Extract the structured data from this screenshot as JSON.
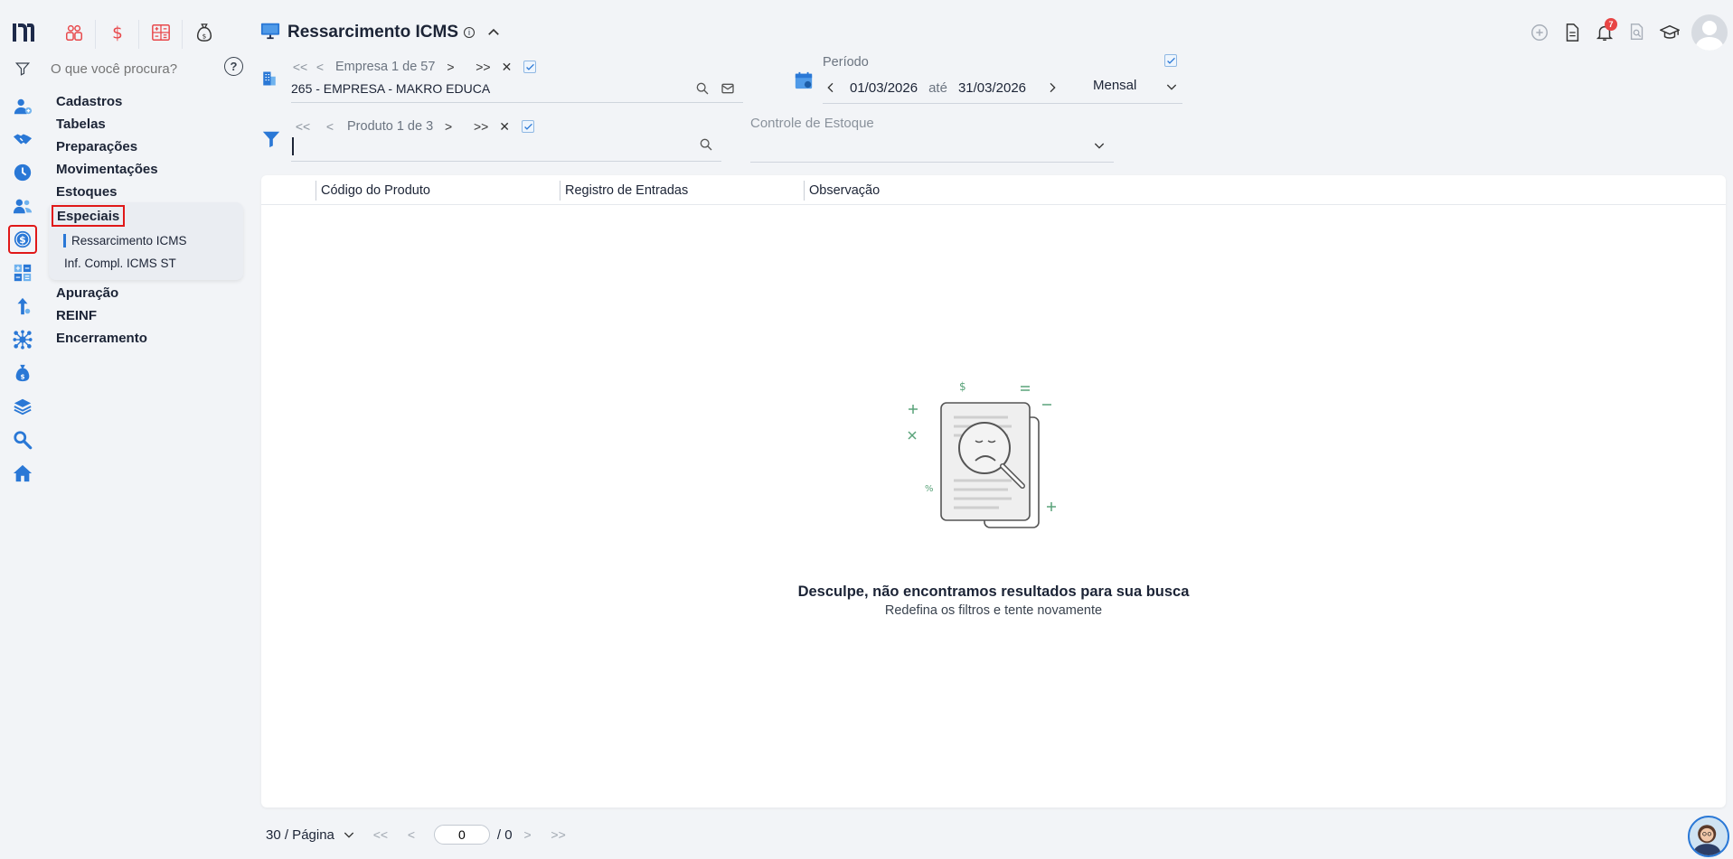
{
  "search": {
    "placeholder": "O que você procura?",
    "help": "?"
  },
  "menu": {
    "items_top": [
      "Cadastros",
      "Tabelas",
      "Preparações",
      "Movimentações",
      "Estoques"
    ],
    "group_label": "Especiais",
    "group_items": [
      "Ressarcimento ICMS",
      "Inf. Compl. ICMS ST"
    ],
    "items_bottom": [
      "Apuração",
      "REINF",
      "Encerramento"
    ]
  },
  "header": {
    "title": "Ressarcimento ICMS",
    "info": "i"
  },
  "notifications": {
    "count": "7"
  },
  "empresa": {
    "first": "<<",
    "prev": "<",
    "label": "Empresa 1 de 57",
    "next": ">",
    "last": ">>",
    "clear": "✕",
    "value": "265 - EMPRESA - MAKRO EDUCA"
  },
  "periodo": {
    "label": "Período",
    "start": "01/03/2026",
    "sep": "até",
    "end": "31/03/2026",
    "mode": "Mensal"
  },
  "produto": {
    "first": "<<",
    "prev": "<",
    "label": "Produto 1 de 3",
    "next": ">",
    "last": ">>",
    "clear": "✕",
    "value": ""
  },
  "controle": {
    "label": "Controle de Estoque"
  },
  "table": {
    "columns": [
      "Código do Produto",
      "Registro de Entradas",
      "Observação"
    ]
  },
  "empty": {
    "title": "Desculpe, não encontramos resultados para sua busca",
    "subtitle": "Redefina os filtros e tente novamente"
  },
  "pager": {
    "per_page": "30 / Página",
    "current": "0",
    "total": "/ 0",
    "first": "<<",
    "prev": "<",
    "next": ">",
    "last": ">>"
  },
  "colors": {
    "accent": "#2a78d6",
    "highlight": "#e01818",
    "brand_red": "#e8474a"
  }
}
